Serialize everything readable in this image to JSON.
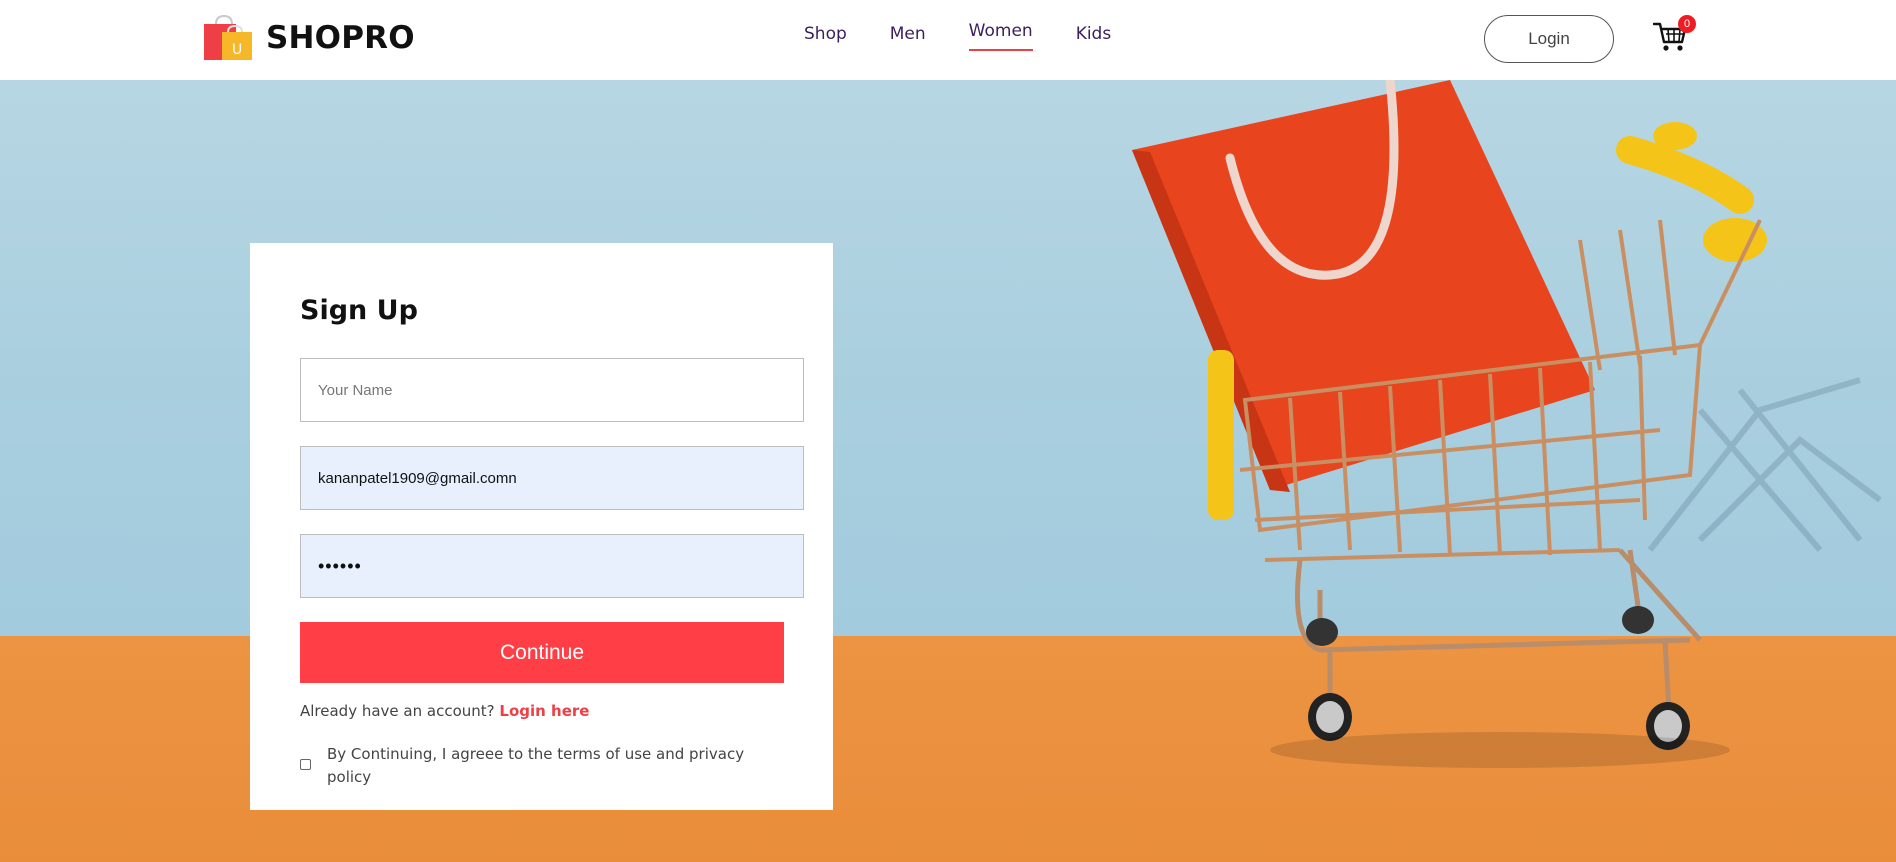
{
  "header": {
    "brand": "SHOPRO",
    "nav": [
      "Shop",
      "Men",
      "Women",
      "Kids"
    ],
    "active_nav": "Women",
    "login_label": "Login",
    "cart_count": "0"
  },
  "signup": {
    "title": "Sign Up",
    "name_placeholder": "Your Name",
    "email_value": "kananpatel1909@gmail.comn",
    "password_value": "••••••",
    "continue_label": "Continue",
    "account_prompt": "Already have an account?",
    "login_link": "Login here",
    "terms_text": "By Continuing, I agreee to the terms of use and privacy policy"
  },
  "colors": {
    "accent": "#ff3e45",
    "nav_text": "#3b1f5c",
    "wall": "#b7d6e3",
    "floor": "#ec9443"
  },
  "icons": [
    "shopping-bag-logo-icon",
    "cart-icon"
  ]
}
